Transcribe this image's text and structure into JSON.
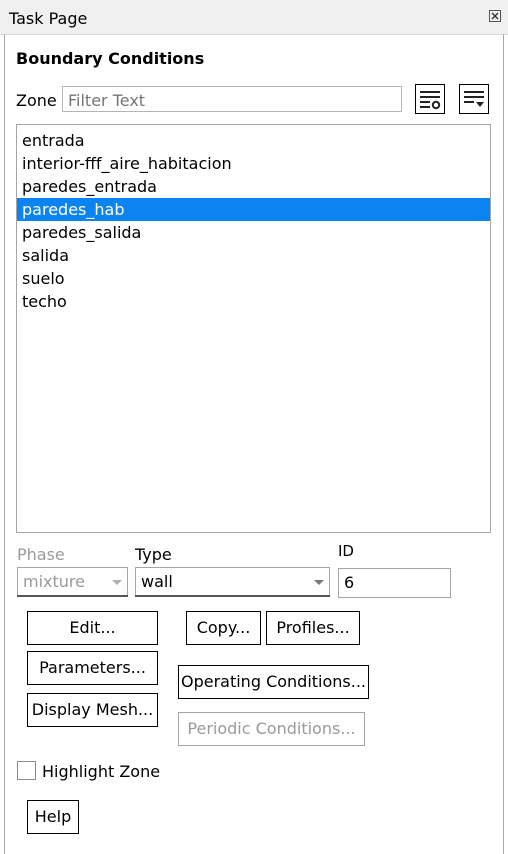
{
  "window": {
    "title": "Task Page",
    "close_icon": "close-box-icon"
  },
  "panel": {
    "heading": "Boundary Conditions"
  },
  "zone": {
    "label": "Zone",
    "filter_placeholder": "Filter Text",
    "filter_value": "",
    "filter_settings_icon": "list-filter-settings-icon",
    "filter_options_icon": "list-filter-dropdown-icon"
  },
  "zones": {
    "items": [
      "entrada",
      "interior-fff_aire_habitacion",
      "paredes_entrada",
      "paredes_hab",
      "paredes_salida",
      "salida",
      "suelo",
      "techo"
    ],
    "selected": "paredes_hab"
  },
  "phase": {
    "label": "Phase",
    "value": "mixture",
    "enabled": false
  },
  "type": {
    "label": "Type",
    "value": "wall"
  },
  "id": {
    "label": "ID",
    "value": "6"
  },
  "buttons": {
    "edit": "Edit...",
    "copy": "Copy...",
    "profiles": "Profiles...",
    "parameters": "Parameters...",
    "operating_conditions": "Operating Conditions...",
    "display_mesh": "Display Mesh...",
    "periodic_conditions": "Periodic Conditions...",
    "help": "Help"
  },
  "highlight_zone": {
    "label": "Highlight Zone",
    "checked": false
  },
  "colors": {
    "selection": "#0b84f1",
    "disabled_text": "#9a9a9a",
    "titlebar": "#f0f0f0"
  }
}
